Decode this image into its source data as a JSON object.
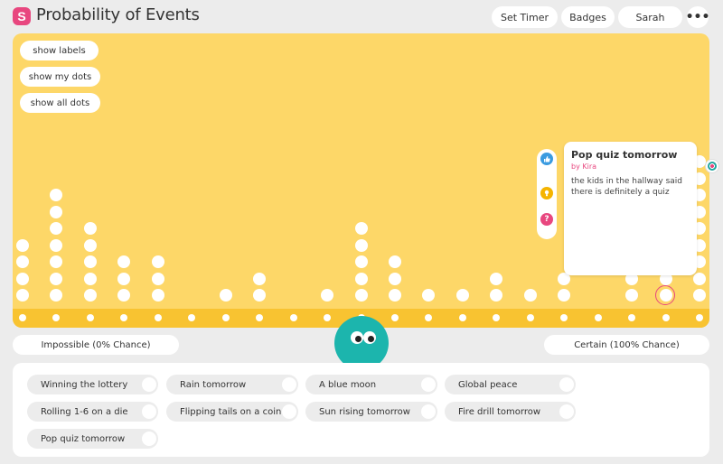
{
  "header": {
    "logo_letter": "S",
    "title": "Probability of Events",
    "buttons": {
      "set_timer": "Set Timer",
      "badges": "Badges",
      "user": "Sarah",
      "more": "•••"
    }
  },
  "board": {
    "toggles": {
      "show_labels": "show labels",
      "show_my_dots": "show my dots",
      "show_all_dots": "show all dots"
    },
    "action_icons": {
      "like": "like-icon",
      "idea": "lightbulb-icon",
      "question": "question-icon"
    },
    "popover": {
      "title": "Pop quiz tomorrow",
      "author": "by Kira",
      "body": "the kids in the hallway said there is definitely a quiz"
    }
  },
  "scale": {
    "left_label": "Impossible (0% Chance)",
    "right_label": "Certain (100% Chance)"
  },
  "events": [
    "Winning the lottery",
    "Rain tomorrow",
    "A blue moon",
    "Global peace",
    "Rolling 1-6 on a die",
    "Flipping tails on a coin",
    "Sun rising tomorrow",
    "Fire drill tomorrow",
    "Pop quiz tomorrow"
  ],
  "colors": {
    "board": "#fdd768",
    "track": "#f8c331",
    "accent_pink": "#e8477f",
    "mascot_teal": "#1cb5ad"
  }
}
